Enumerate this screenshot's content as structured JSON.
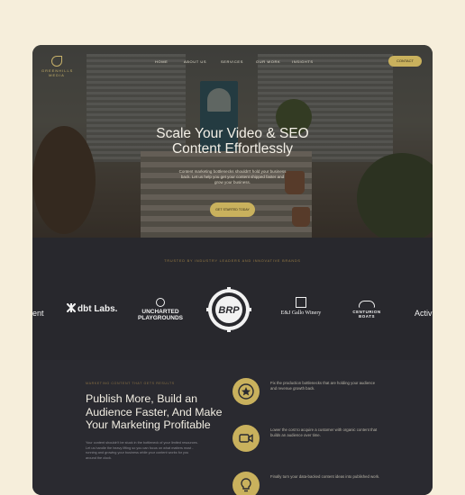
{
  "site": {
    "logo_text": "GREENHILLS MEDIA"
  },
  "nav": {
    "items": [
      "HOME",
      "ABOUT US",
      "SERVICES",
      "OUR WORK",
      "INSIGHTS"
    ],
    "cta": "CONTACT"
  },
  "hero": {
    "title_line1": "Scale Your Video & SEO",
    "title_line2": "Content Effortlessly",
    "subtitle": "Content marketing bottlenecks shouldn't hold your business back. Let us help you get your content shipped faster and grow your business.",
    "cta": "GET STARTED TODAY"
  },
  "logos": {
    "label": "TRUSTED BY INDUSTRY LEADERS AND INNOVATIVE BRANDS",
    "brands": {
      "ent": "ent",
      "dbt": "dbt Labs.",
      "uncharted_line1": "UNCHARTED",
      "uncharted_line2": "PLAYGROUNDS",
      "brp": "BRP",
      "gallo": "E&J Gallo Winery",
      "centurion_line1": "CENTURION",
      "centurion_line2": "BOATS",
      "act": "Activ"
    }
  },
  "content": {
    "eyebrow": "MARKETING CONTENT THAT GETS RESULTS",
    "headline": "Publish More, Build an Audience Faster, And Make Your Marketing Profitable",
    "paragraph": "Your content shouldn't be stuck in the bottleneck of your limited resources. Let us handle the heavy lifting so you can focus on what matters most - running and growing your business while your content works for you around the clock.",
    "features": [
      {
        "icon": "star-badge-icon",
        "text": "Fix the production bottlenecks that are holding your audience and revenue growth back."
      },
      {
        "icon": "video-camera-icon",
        "text": "Lower the cost to acquire a customer with organic content that builds an audience over time."
      },
      {
        "icon": "lightbulb-icon",
        "text": "Finally turn your data-backed content ideas into published work."
      }
    ]
  },
  "colors": {
    "page_bg": "#f6eedb",
    "accent": "#c9b15d",
    "dark": "#28282d"
  }
}
